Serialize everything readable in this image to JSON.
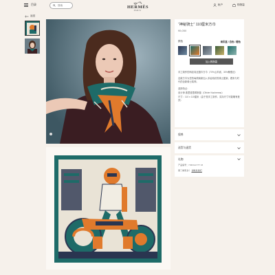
{
  "header": {
    "menu_label": "目录",
    "search_placeholder": "搜索",
    "logo_word": "HERMÈS",
    "logo_sub": "PARIS",
    "account_label": "帐户",
    "cart_label": "购物袋"
  },
  "nav": {
    "back_label": "返回"
  },
  "product": {
    "title": "“神秘骑士” 110厘米方巾",
    "price": "¥5,050",
    "color_label": "颜色",
    "color_selected": "海军蓝 / 白色 / 橙色",
    "add_button": "加入购物袋",
    "description": [
      "手工制作的斜纹真丝围巾方巾（70%山羊绒，30%桑蚕丝）",
      "这款方巾为您的每周焕新加入手绘精彩的骑士图案，看来与时代的全新骑士精神。",
      "选择特点：",
      "设计师 弗里德里希斯普（Olivier Kachereau）",
      "尺寸：110 x 110厘米（由于是手工制作，实际尺寸可能略有差异）"
    ]
  },
  "accordion": {
    "item1": "保养",
    "item2": "送货与退货",
    "item3": "礼物"
  },
  "gift": {
    "line1": "产品编号：H003ALT7T 03",
    "line2_prefix": "需了解更多？",
    "line2_link": "请联系我们"
  },
  "colors": {
    "teal": "#1e6b68",
    "orange": "#e07a2c",
    "navy": "#2a3550",
    "button": "#555555"
  },
  "icons": [
    "menu-icon",
    "search-icon",
    "account-icon",
    "bag-icon",
    "arrow-left-icon",
    "chevron-down-icon"
  ]
}
